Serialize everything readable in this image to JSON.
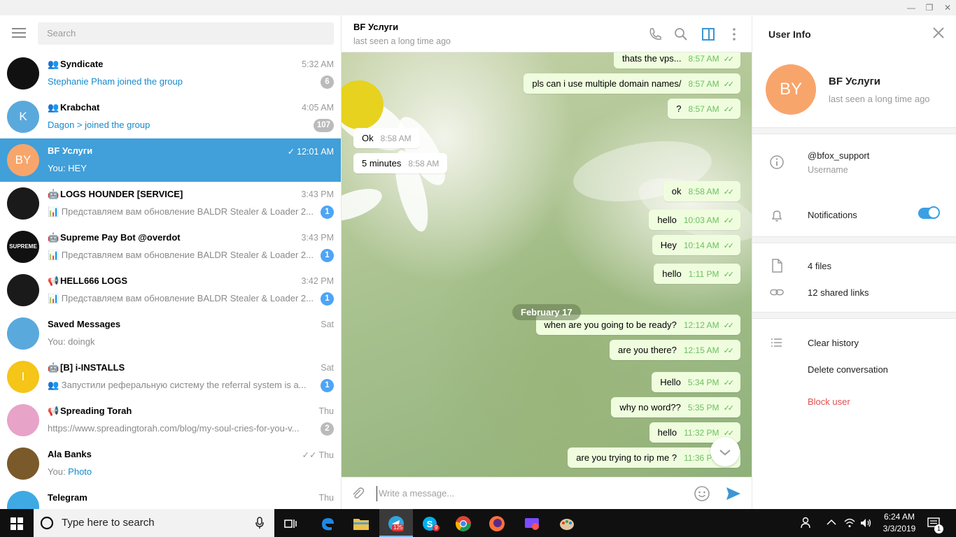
{
  "window": {
    "minimize": "—",
    "maximize": "❐",
    "close": "✕"
  },
  "sidebar": {
    "search_placeholder": "Search",
    "chats": [
      {
        "name": "Syndicate",
        "type_icon": "group-icon",
        "time": "5:32 AM",
        "sender": "",
        "preview": "Stephanie Pham joined the group",
        "preview_style": "blue",
        "badge": "6",
        "badge_style": "muted",
        "avatar_text": "",
        "avatar_color": "#111111"
      },
      {
        "name": "Krabchat",
        "type_icon": "group-icon",
        "time": "4:05 AM",
        "sender": "",
        "preview": "Dagon > joined the group",
        "preview_style": "blue",
        "badge": "107",
        "badge_style": "muted",
        "avatar_text": "K",
        "avatar_color": "#5aa9dd"
      },
      {
        "name": "BF Услуги",
        "type_icon": "",
        "time": "12:01 AM",
        "sender": "You: ",
        "preview": "HEY",
        "preview_style": "plain",
        "badge": "",
        "badge_style": "",
        "avatar_text": "BY",
        "avatar_color": "#f8a56c",
        "read_check": "✓"
      },
      {
        "name": "LOGS HOUNDER [SERVICE]",
        "type_icon": "bot-icon",
        "time": "3:43 PM",
        "sender": "",
        "preview": "📊 Представляем вам обновление BALDR Stealer & Loader 2...",
        "preview_style": "plain",
        "badge": "1",
        "badge_style": "blue",
        "avatar_text": "",
        "avatar_color": "#1a1a1a"
      },
      {
        "name": "Supreme Pay Bot @overdot",
        "type_icon": "bot-icon",
        "time": "3:43 PM",
        "sender": "",
        "preview": "📊 Представляем вам обновление BALDR Stealer & Loader 2...",
        "preview_style": "plain",
        "badge": "1",
        "badge_style": "blue",
        "avatar_text": "SUPREME",
        "avatar_color": "#111111"
      },
      {
        "name": "HELL666 LOGS",
        "type_icon": "channel-icon",
        "time": "3:42 PM",
        "sender": "",
        "preview": "📊 Представляем вам обновление BALDR Stealer & Loader 2...",
        "preview_style": "plain",
        "badge": "1",
        "badge_style": "blue",
        "avatar_text": "",
        "avatar_color": "#1a1a1a"
      },
      {
        "name": "Saved Messages",
        "type_icon": "",
        "time": "Sat",
        "sender": "You: ",
        "preview": "doingk",
        "preview_style": "plain",
        "badge": "",
        "badge_style": "",
        "avatar_text": "",
        "avatar_color": "#5aa9dd"
      },
      {
        "name": "[B] i-INSTALLS",
        "type_icon": "bot-icon",
        "time": "Sat",
        "sender": "",
        "preview": "👥 Запустили реферальную систему  the referral system is a...",
        "preview_style": "plain",
        "badge": "1",
        "badge_style": "blue",
        "avatar_text": "I",
        "avatar_color": "#f5c518"
      },
      {
        "name": "Spreading Torah",
        "type_icon": "channel-icon",
        "time": "Thu",
        "sender": "",
        "preview": "https://www.spreadingtorah.com/blog/my-soul-cries-for-you-v...",
        "preview_style": "plain",
        "badge": "2",
        "badge_style": "muted",
        "avatar_text": "",
        "avatar_color": "#e7a3c8"
      },
      {
        "name": "Ala Banks",
        "type_icon": "",
        "time": "Thu",
        "sender": "You: ",
        "preview": "Photo",
        "preview_style": "blue",
        "badge": "",
        "badge_style": "",
        "avatar_text": "",
        "avatar_color": "#7a5a2a",
        "read_check": "✓✓"
      },
      {
        "name": "Telegram",
        "type_icon": "",
        "time": "Thu",
        "sender": "",
        "preview": "",
        "preview_style": "plain",
        "badge": "",
        "badge_style": "",
        "avatar_text": "",
        "avatar_color": "#3fa9e4"
      }
    ]
  },
  "chat": {
    "title": "BF Услуги",
    "status": "last seen a long time ago",
    "messages": [
      {
        "text": "thats the vps...",
        "time": "8:57 AM",
        "dir": "out"
      },
      {
        "text": "pls can i use multiple domain names/",
        "time": "8:57 AM",
        "dir": "out"
      },
      {
        "text": "?",
        "time": "8:57 AM",
        "dir": "out"
      },
      {
        "text": "Ok",
        "time": "8:58 AM",
        "dir": "in"
      },
      {
        "text": "5 minutes",
        "time": "8:58 AM",
        "dir": "in"
      },
      {
        "text": "ok",
        "time": "8:58 AM",
        "dir": "out"
      },
      {
        "text": "hello",
        "time": "10:03 AM",
        "dir": "out"
      },
      {
        "text": "Hey",
        "time": "10:14 AM",
        "dir": "out"
      },
      {
        "text": "hello",
        "time": "1:11 PM",
        "dir": "out"
      },
      {
        "text": "when are you going to be ready?",
        "time": "12:12 AM",
        "dir": "out"
      },
      {
        "text": "are you there?",
        "time": "12:15 AM",
        "dir": "out"
      },
      {
        "text": "Hello",
        "time": "5:34 PM",
        "dir": "out"
      },
      {
        "text": "why no word??",
        "time": "5:35 PM",
        "dir": "out"
      },
      {
        "text": "hello",
        "time": "11:32 PM",
        "dir": "out"
      },
      {
        "text": "are you trying to rip me ?",
        "time": "11:36 PM",
        "dir": "out"
      }
    ],
    "date_separator": "February 17",
    "compose_placeholder": "Write a message..."
  },
  "user_info": {
    "title": "User Info",
    "avatar_text": "BY",
    "name": "BF Услуги",
    "status": "last seen a long time ago",
    "username": "@bfox_support",
    "username_label": "Username",
    "notifications_label": "Notifications",
    "notifications_on": true,
    "files": "4 files",
    "links": "12 shared links",
    "clear_history": "Clear history",
    "delete_conversation": "Delete conversation",
    "block_user": "Block user"
  },
  "taskbar": {
    "search_placeholder": "Type here to search",
    "telegram_badge": "125",
    "skype_badge": "9",
    "time": "6:24 AM",
    "date": "3/3/2019",
    "notification_count": "1"
  },
  "colors": {
    "accent": "#419fd9",
    "out_bubble": "#effdde",
    "danger": "#e05050"
  }
}
